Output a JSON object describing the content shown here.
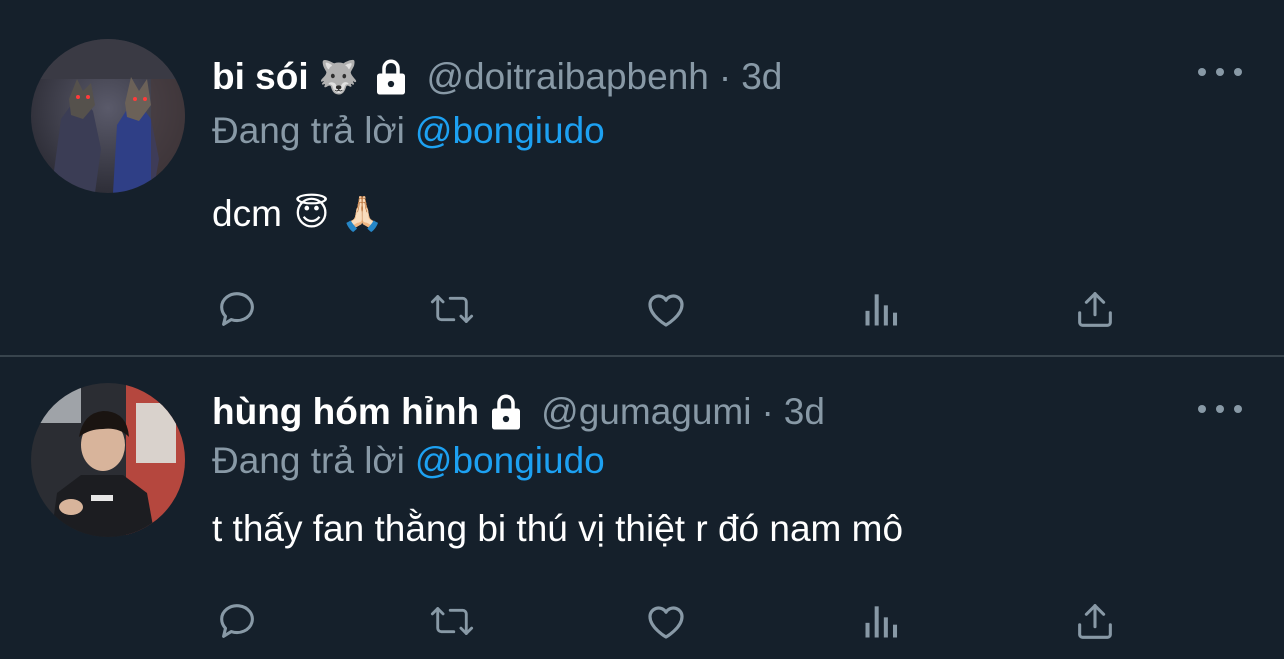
{
  "colors": {
    "background": "#15202b",
    "divider": "#38444d",
    "secondary_text": "#8899a6",
    "link": "#1da1f2",
    "primary_text": "#ffffff"
  },
  "tweets": [
    {
      "display_name": "bi sói",
      "name_emoji": "🐺",
      "protected_icon": "lock-icon",
      "handle": "@doitraibapbenh",
      "separator": "·",
      "time": "3d",
      "replying_prefix": "Đang trả lời",
      "replying_to": "@bongiudo",
      "text": "dcm",
      "text_emojis": [
        "😇",
        "🙏🏻"
      ],
      "actions": [
        "reply-icon",
        "retweet-icon",
        "like-icon",
        "analytics-icon",
        "share-icon"
      ]
    },
    {
      "display_name": "hùng hóm hỉnh",
      "protected_icon": "lock-icon",
      "handle": "@gumagumi",
      "separator": "·",
      "time": "3d",
      "replying_prefix": "Đang trả lời",
      "replying_to": "@bongiudo",
      "text": "t thấy fan thằng bi thú vị thiệt r đó nam mô",
      "actions": [
        "reply-icon",
        "retweet-icon",
        "like-icon",
        "analytics-icon",
        "share-icon"
      ]
    }
  ]
}
